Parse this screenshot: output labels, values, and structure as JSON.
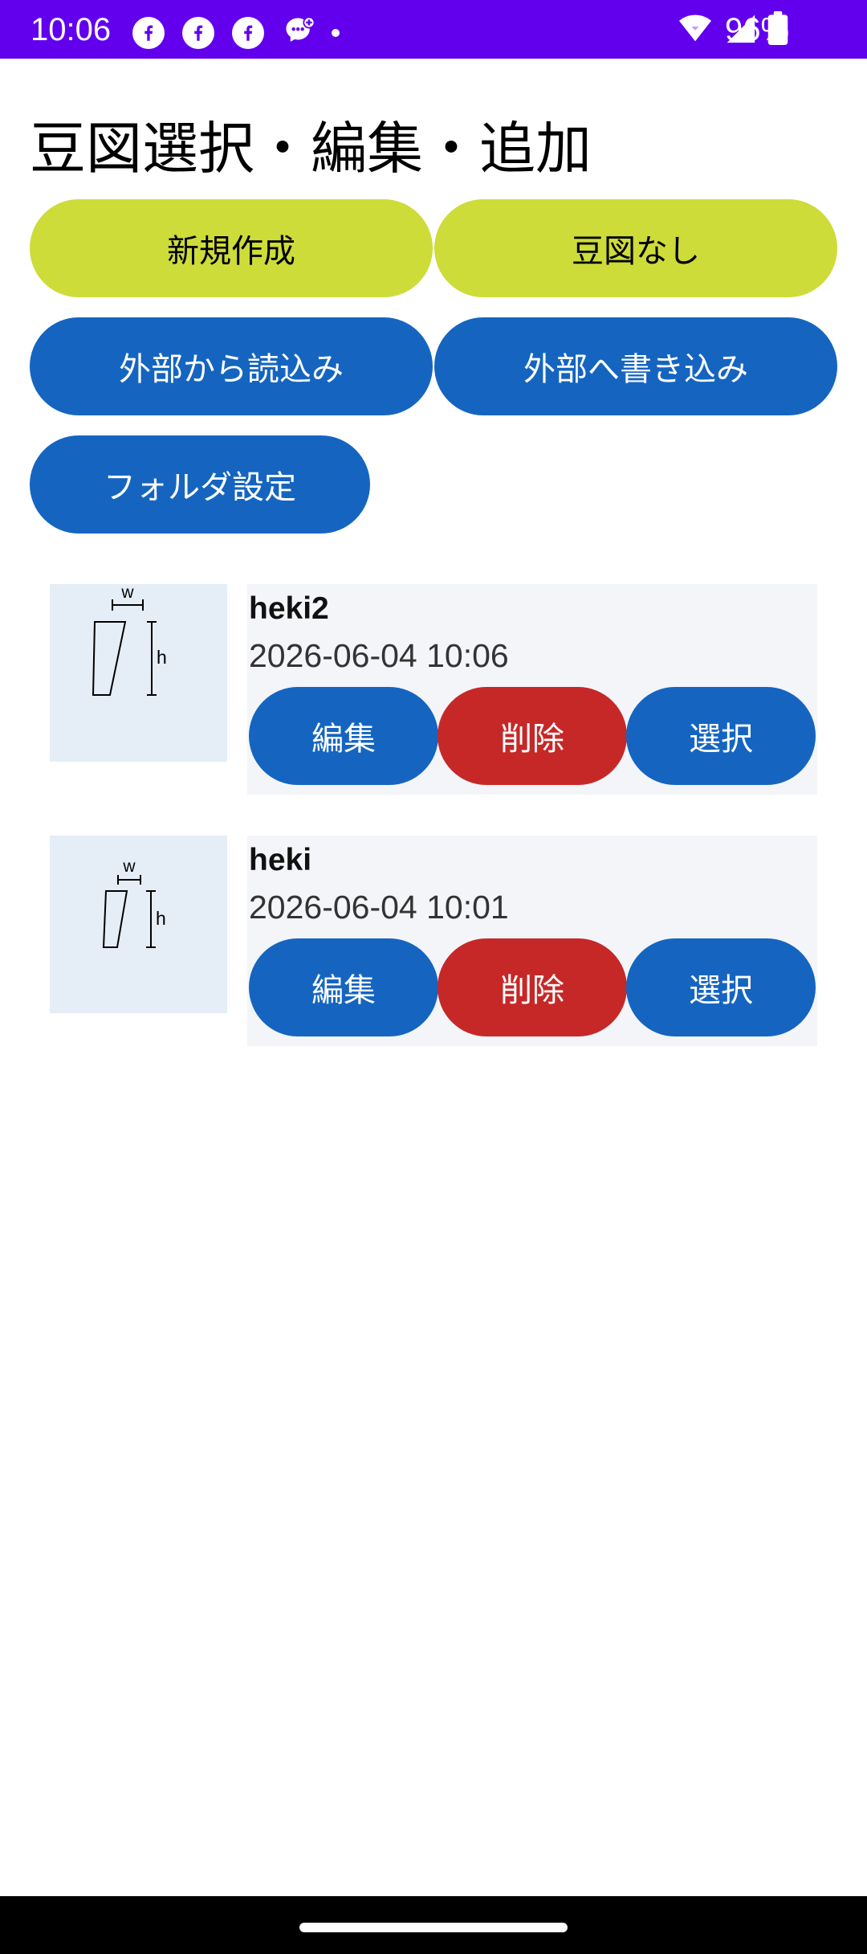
{
  "status_bar": {
    "time": "10:06",
    "battery_percent": "96%",
    "background": "#6200ee",
    "icons": [
      "facebook-icon",
      "facebook-icon",
      "facebook-icon",
      "messenger-icon",
      "notification-dot-icon",
      "wifi-icon",
      "signal-icon",
      "battery-icon"
    ]
  },
  "page": {
    "title": "豆図選択・編集・追加"
  },
  "actions": {
    "new_label": "新規作成",
    "none_label": "豆図なし",
    "import_label": "外部から読込み",
    "export_label": "外部へ書き込み",
    "folder_label": "フォルダ設定"
  },
  "items": [
    {
      "name": "heki2",
      "date": "2026-06-04 10:06",
      "edit_label": "編集",
      "delete_label": "削除",
      "select_label": "選択",
      "thumb_w_label": "w",
      "thumb_h_label": "h"
    },
    {
      "name": "heki",
      "date": "2026-06-04 10:01",
      "edit_label": "編集",
      "delete_label": "削除",
      "select_label": "選択",
      "thumb_w_label": "w",
      "thumb_h_label": "h"
    }
  ],
  "colors": {
    "accent_yellow": "#cddc39",
    "primary_blue": "#1565c0",
    "danger_red": "#c62828",
    "thumb_bg": "#e5edf6",
    "card_bg": "#f3f5f9"
  }
}
